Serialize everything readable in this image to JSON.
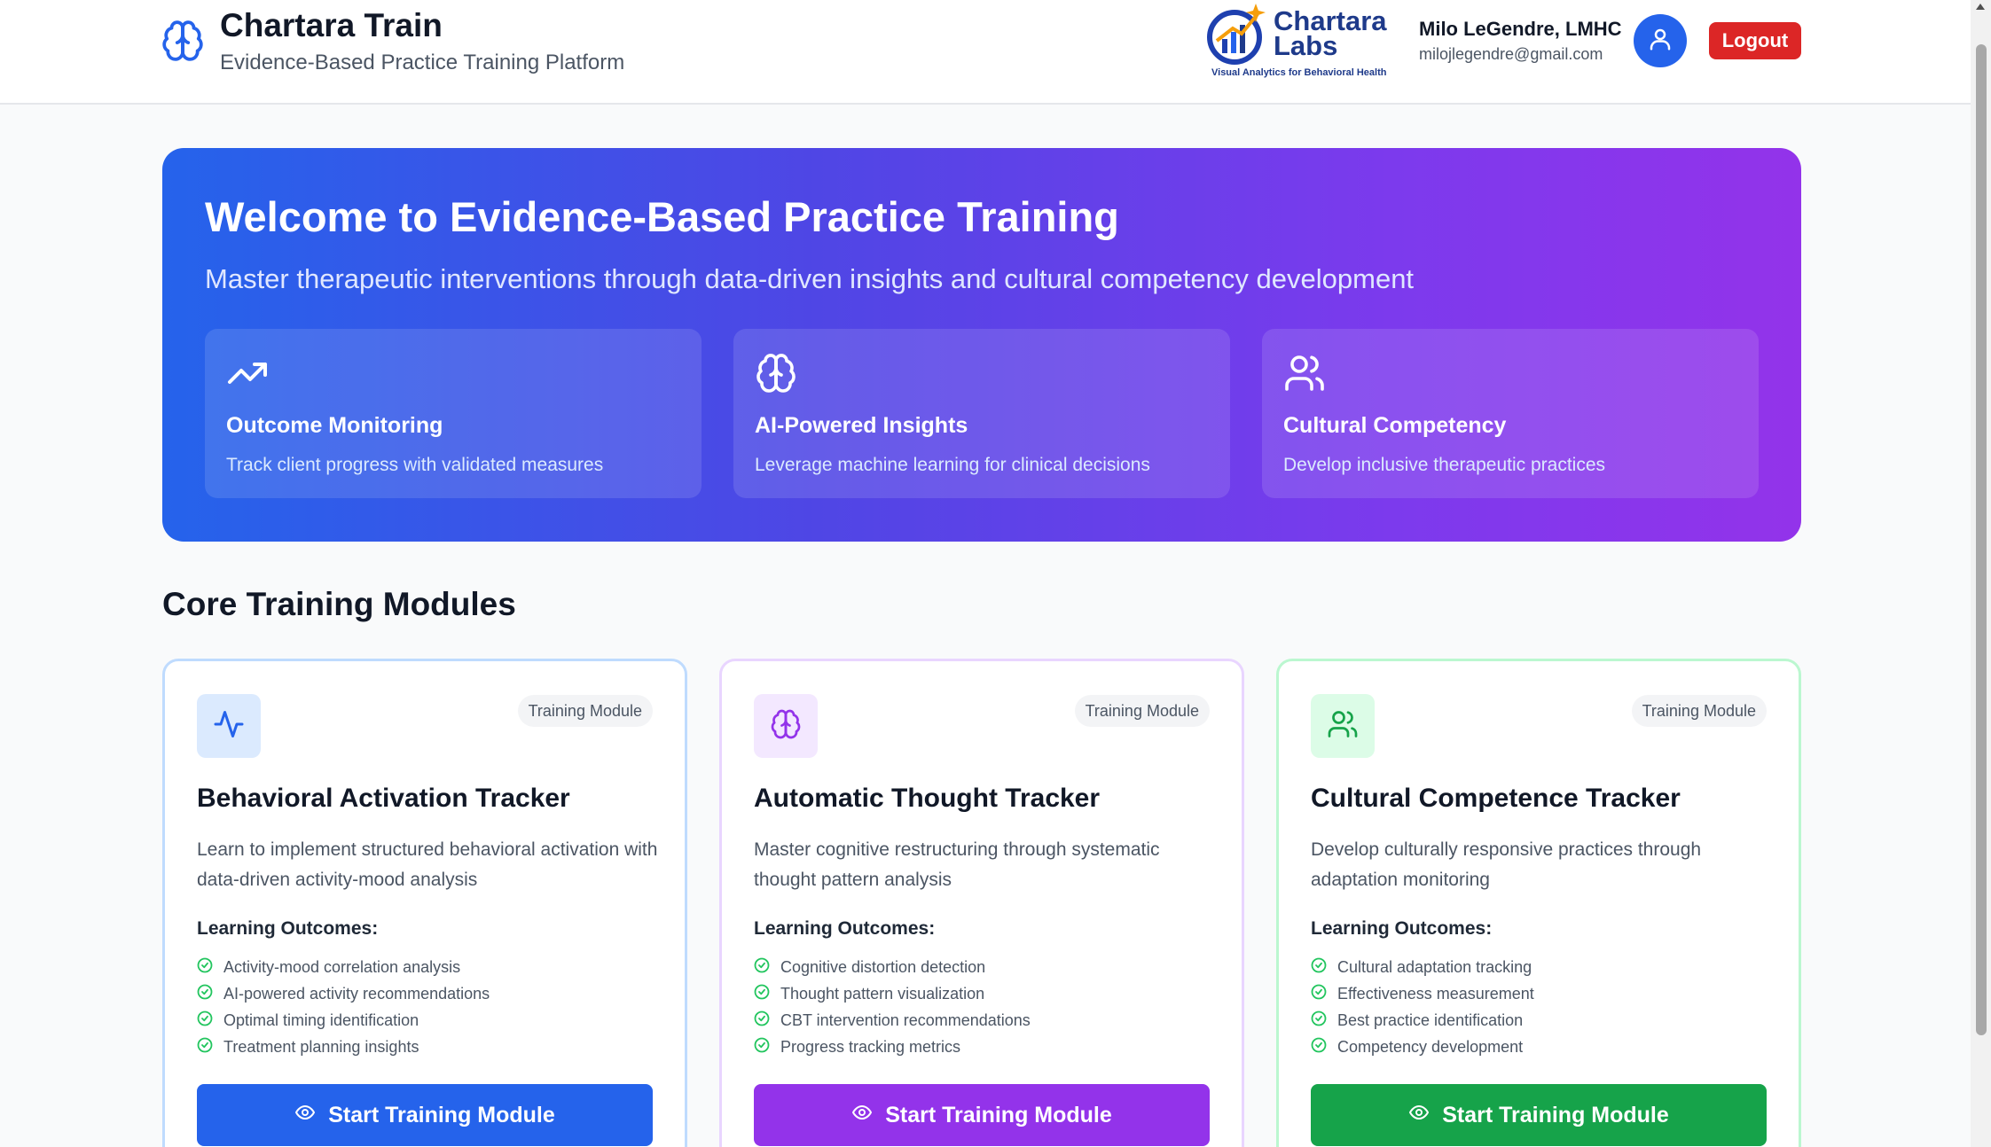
{
  "header": {
    "app_title": "Chartara Train",
    "app_subtitle": "Evidence-Based Practice Training Platform",
    "brand_icon": "brain-icon",
    "partner": {
      "name_line1": "Chartara",
      "name_line2": "Labs",
      "tagline": "Visual Analytics for Behavioral Health"
    },
    "user": {
      "name": "Milo LeGendre, LMHC",
      "email": "milojlegendre@gmail.com",
      "avatar_icon": "user-icon"
    },
    "logout_label": "Logout"
  },
  "hero": {
    "title": "Welcome to Evidence-Based Practice Training",
    "lead": "Master therapeutic interventions through data-driven insights and cultural competency development",
    "features": [
      {
        "icon": "trending-up-icon",
        "title": "Outcome Monitoring",
        "desc": "Track client progress with validated measures"
      },
      {
        "icon": "brain-icon",
        "title": "AI-Powered Insights",
        "desc": "Leverage machine learning for clinical decisions"
      },
      {
        "icon": "users-icon",
        "title": "Cultural Competency",
        "desc": "Develop inclusive therapeutic practices"
      }
    ]
  },
  "modules": {
    "section_title": "Core Training Modules",
    "items": [
      {
        "icon": "activity-icon",
        "badge": "Training Module",
        "title": "Behavioral Activation Tracker",
        "desc": "Learn to implement structured behavioral activation with data-driven activity-mood analysis",
        "outcomes_label": "Learning Outcomes:",
        "outcomes": [
          "Activity-mood correlation analysis",
          "AI-powered activity recommendations",
          "Optimal timing identification",
          "Treatment planning insights"
        ],
        "button_label": "Start Training Module",
        "accent": "#2563eb"
      },
      {
        "icon": "brain-icon",
        "badge": "Training Module",
        "title": "Automatic Thought Tracker",
        "desc": "Master cognitive restructuring through systematic thought pattern analysis",
        "outcomes_label": "Learning Outcomes:",
        "outcomes": [
          "Cognitive distortion detection",
          "Thought pattern visualization",
          "CBT intervention recommendations",
          "Progress tracking metrics"
        ],
        "button_label": "Start Training Module",
        "accent": "#9333ea"
      },
      {
        "icon": "users-icon",
        "badge": "Training Module",
        "title": "Cultural Competence Tracker",
        "desc": "Develop culturally responsive practices through adaptation monitoring",
        "outcomes_label": "Learning Outcomes:",
        "outcomes": [
          "Cultural adaptation tracking",
          "Effectiveness measurement",
          "Best practice identification",
          "Competency development"
        ],
        "button_label": "Start Training Module",
        "accent": "#16a34a"
      }
    ]
  }
}
